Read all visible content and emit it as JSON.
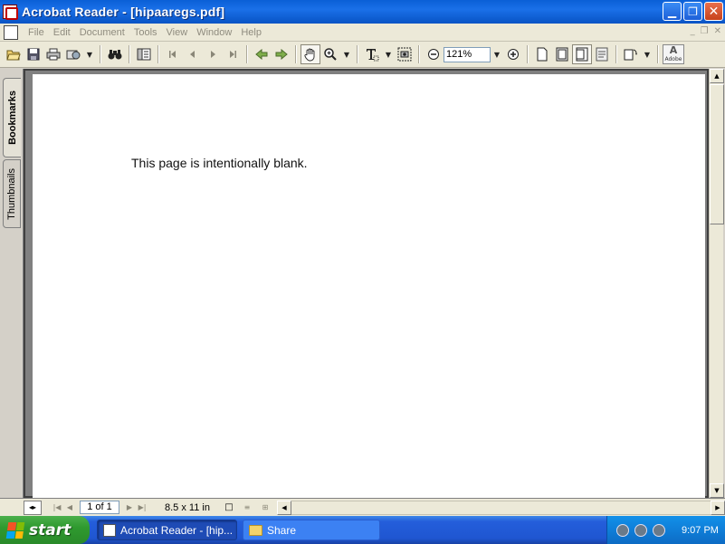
{
  "window": {
    "title": "Acrobat Reader - [hipaaregs.pdf]",
    "minimize_glyph": "▁",
    "restore_glyph": "❐",
    "close_glyph": "✕"
  },
  "menu": {
    "items": [
      "File",
      "Edit",
      "Document",
      "Tools",
      "View",
      "Window",
      "Help"
    ],
    "mdi_minimize": "_",
    "mdi_restore": "❐",
    "mdi_close": "✕"
  },
  "toolbar": {
    "open_icon": "folder-open-icon",
    "save_icon": "save-icon",
    "print_icon": "print-icon",
    "email_icon": "email-icon",
    "search_icon": "binoculars-icon",
    "nav_pane_icon": "navigation-pane-icon",
    "first_page_icon": "first-page-icon",
    "prev_page_icon": "previous-page-icon",
    "next_page_icon": "next-page-icon",
    "last_page_icon": "last-page-icon",
    "back_icon": "back-icon",
    "forward_icon": "forward-icon",
    "hand_icon": "hand-tool-icon",
    "zoom_tool_icon": "zoom-in-tool-icon",
    "text_select_icon": "text-select-icon",
    "snapshot_icon": "snapshot-icon",
    "zoom_out_icon": "zoom-out-icon",
    "zoom_value": "121%",
    "zoom_in_icon": "zoom-in-icon",
    "actual_size_icon": "actual-size-icon",
    "fit_page_icon": "fit-page-icon",
    "fit_width_icon": "fit-width-icon",
    "reflow_icon": "reflow-icon",
    "rotate_icon": "rotate-view-icon",
    "adobe_logo_text": "Adobe"
  },
  "nav_tabs": [
    {
      "label": "Bookmarks",
      "active": true
    },
    {
      "label": "Thumbnails",
      "active": false
    }
  ],
  "document": {
    "page_text": "This page is intentionally blank."
  },
  "statusbar": {
    "page_indicator": "1 of 1",
    "page_size": "8.5 x 11 in"
  },
  "taskbar": {
    "start_label": "start",
    "items": [
      {
        "label": "Acrobat Reader - [hip...",
        "active": true
      },
      {
        "label": "Share",
        "active": false
      }
    ],
    "clock": "9:07 PM"
  },
  "colors": {
    "title_bar": "#0a5fd6",
    "taskbar": "#245edb",
    "start_button": "#2f9a2f",
    "page_background": "#ffffff",
    "doc_background": "#808080"
  }
}
